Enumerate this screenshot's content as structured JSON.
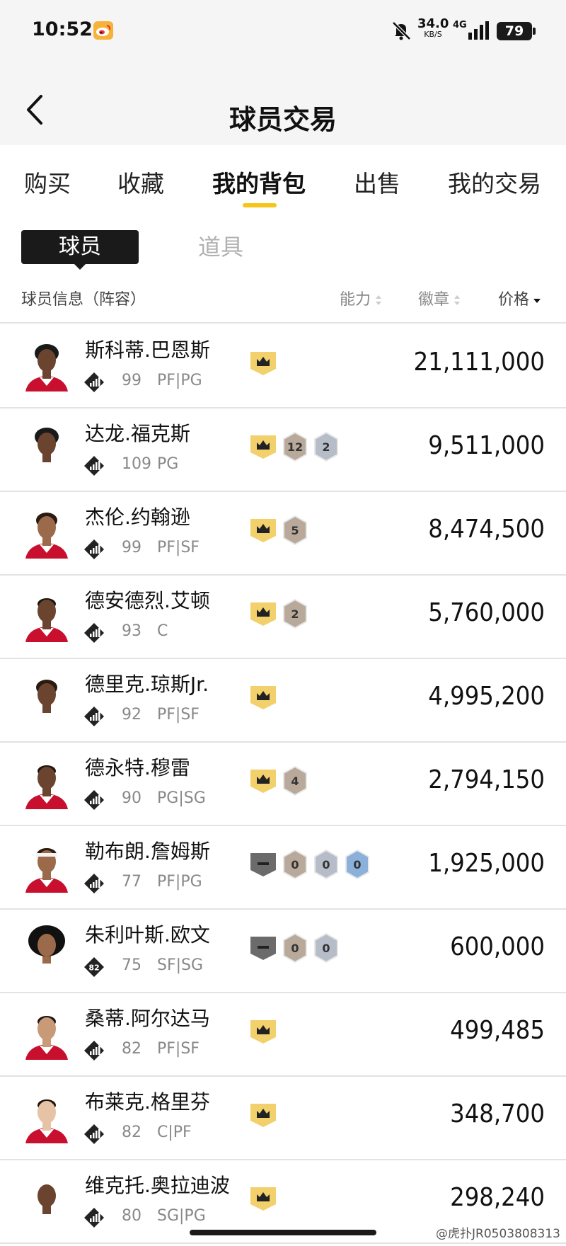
{
  "status_bar": {
    "time": "10:52",
    "net_speed_value": "34.0",
    "net_speed_unit": "KB/S",
    "network": "4G",
    "battery": "79"
  },
  "header": {
    "title": "球员交易"
  },
  "tabs": [
    {
      "label": "购买",
      "active": false
    },
    {
      "label": "收藏",
      "active": false
    },
    {
      "label": "我的背包",
      "active": true
    },
    {
      "label": "出售",
      "active": false
    },
    {
      "label": "我的交易",
      "active": false
    }
  ],
  "segments": {
    "player": "球员",
    "item": "道具"
  },
  "columns": {
    "info": "球员信息（阵容）",
    "ability": "能力",
    "badge": "徽章",
    "price": "价格"
  },
  "players": [
    {
      "name": "斯科蒂.巴恩斯",
      "rating": "99",
      "positions": "PF|PG",
      "price": "21,111,000",
      "card": "crown",
      "badges": [],
      "skin": "dark",
      "hair": "afro"
    },
    {
      "name": "达龙.福克斯",
      "rating": "109",
      "positions": "PG",
      "price": "9,511,000",
      "card": "crown",
      "badges": [
        {
          "type": "bronze",
          "num": "12"
        },
        {
          "type": "silver",
          "num": "2"
        }
      ],
      "skin": "dark",
      "hair": "afro"
    },
    {
      "name": "杰伦.约翰逊",
      "rating": "99",
      "positions": "PF|SF",
      "price": "8,474,500",
      "card": "crown",
      "badges": [
        {
          "type": "bronze",
          "num": "5"
        }
      ],
      "skin": "medium",
      "hair": "curly"
    },
    {
      "name": "德安德烈.艾顿",
      "rating": "93",
      "positions": "C",
      "price": "5,760,000",
      "card": "crown",
      "badges": [
        {
          "type": "bronze",
          "num": "2"
        }
      ],
      "skin": "dark",
      "hair": "short"
    },
    {
      "name": "德里克.琼斯Jr.",
      "rating": "92",
      "positions": "PF|SF",
      "price": "4,995,200",
      "card": "crown",
      "badges": [],
      "skin": "dark",
      "hair": "curly"
    },
    {
      "name": "德永特.穆雷",
      "rating": "90",
      "positions": "PG|SG",
      "price": "2,794,150",
      "card": "crown",
      "badges": [
        {
          "type": "bronze",
          "num": "4"
        }
      ],
      "skin": "dark",
      "hair": "short"
    },
    {
      "name": "勒布朗.詹姆斯",
      "rating": "77",
      "positions": "PF|PG",
      "price": "1,925,000",
      "card": "dash",
      "badges": [
        {
          "type": "bronze",
          "num": "0"
        },
        {
          "type": "silver",
          "num": "0"
        },
        {
          "type": "blue",
          "num": "0"
        }
      ],
      "skin": "medium",
      "hair": "headband"
    },
    {
      "name": "朱利叶斯.欧文",
      "rating": "75",
      "positions": "SF|SG",
      "price": "600,000",
      "card": "dash",
      "badges": [
        {
          "type": "bronze",
          "num": "0"
        },
        {
          "type": "silver",
          "num": "0"
        }
      ],
      "skin": "medium",
      "hair": "bigafro",
      "icon_label": "82"
    },
    {
      "name": "桑蒂.阿尔达马",
      "rating": "82",
      "positions": "PF|SF",
      "price": "499,485",
      "card": "crown",
      "badges": [],
      "skin": "light",
      "hair": "short"
    },
    {
      "name": "布莱克.格里芬",
      "rating": "82",
      "positions": "C|PF",
      "price": "348,700",
      "card": "crown",
      "badges": [],
      "skin": "pale",
      "hair": "short"
    },
    {
      "name": "维克托.奥拉迪波",
      "rating": "80",
      "positions": "SG|PG",
      "price": "298,240",
      "card": "crown",
      "badges": [],
      "skin": "dark",
      "hair": "bald"
    }
  ],
  "watermark": "@虎扑JR0503808313",
  "colors": {
    "accent": "#f5c518",
    "crown_card": "#f2d06b",
    "dash_card": "#6b6b6b",
    "bronze": "#b8a99a",
    "silver": "#b7bdc8",
    "blue": "#8bb0da"
  }
}
